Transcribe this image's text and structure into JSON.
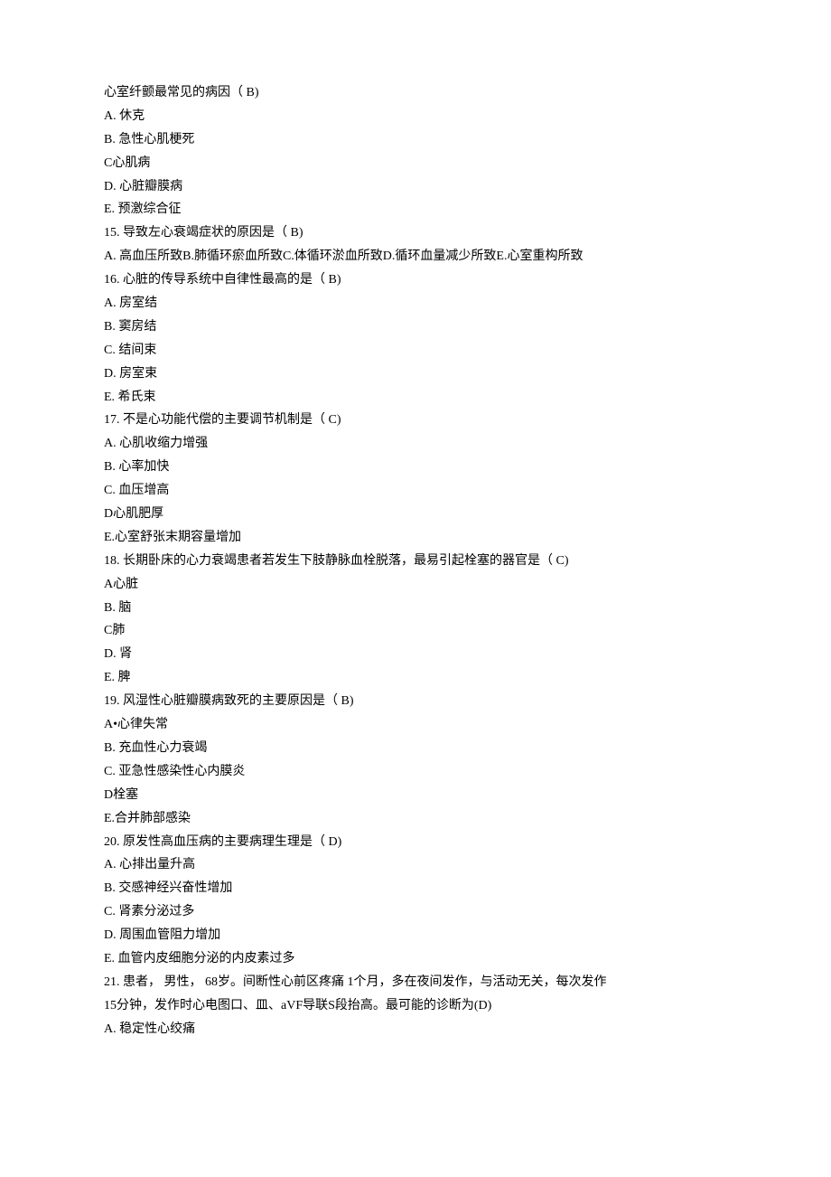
{
  "lines": [
    "心室纤颤最常见的病因（ B)",
    "A.  休克",
    "B.  急性心肌梗死",
    "C心肌病",
    "D.     心脏瓣膜病",
    "E.     预激综合征",
    "15.   导致左心衰竭症状的原因是（ B)",
    "A.     高血压所致B.肺循环瘀血所致C.体循环淤血所致D.循环血量减少所致E.心室重构所致",
    "16.   心脏的传导系统中自律性最高的是（ B)",
    "A.  房室结",
    "B.  窦房结",
    "C.  结间束",
    "D.  房室束",
    "E.  希氏束",
    "17.   不是心功能代偿的主要调节机制是（ C)",
    "A.  心肌收缩力增强",
    "B.  心率加快",
    "C.  血压增高",
    "D心肌肥厚",
    "E.心室舒张末期容量增加",
    "18.   长期卧床的心力衰竭患者若发生下肢静脉血栓脱落，最易引起栓塞的器官是（ C)",
    "A心脏",
    "B.     脑",
    "C肺",
    "D.  肾",
    "E.  脾",
    "19.   风湿性心脏瓣膜病致死的主要原因是（ B)",
    "A•心律失常",
    "B.  充血性心力衰竭",
    "C.  亚急性感染性心内膜炎",
    "D栓塞",
    "E.合并肺部感染",
    "20.   原发性高血压病的主要病理生理是（ D)",
    "A.  心排出量升高",
    "B.  交感神经兴奋性增加",
    "C.  肾素分泌过多",
    "D.  周围血管阻力增加",
    "E.  血管内皮细胞分泌的内皮素过多",
    "21.   患者，  男性，  68岁。间断性心前区疼痛 1个月，多在夜间发作，与活动无关，每次发作",
    "15分钟，发作时心电图口、皿、aVF导联S段抬高。最可能的诊断为(D)",
    "A.  稳定性心绞痛"
  ]
}
